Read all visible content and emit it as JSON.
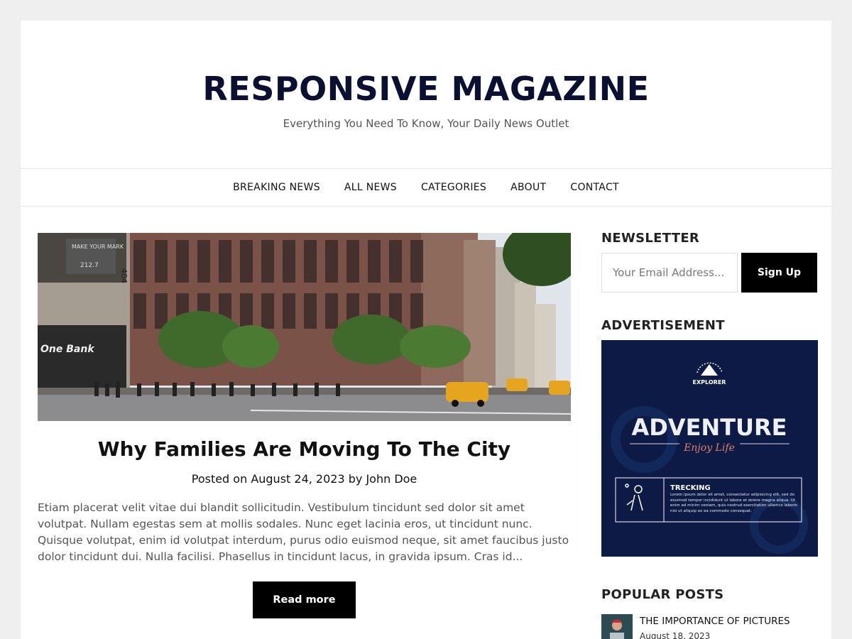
{
  "site": {
    "title": "RESPONSIVE MAGAZINE",
    "tagline": "Everything You Need To Know, Your Daily News Outlet"
  },
  "nav": {
    "items": [
      "BREAKING NEWS",
      "ALL NEWS",
      "CATEGORIES",
      "ABOUT",
      "CONTACT"
    ]
  },
  "post": {
    "title": "Why Families Are Moving To The City",
    "meta": "Posted on August 24, 2023 by John Doe",
    "excerpt": "Etiam placerat velit vitae dui blandit sollicitudin. Vestibulum tincidunt sed dolor sit amet volutpat. Nullam egestas sem at mollis sodales. Nunc eget lacinia eros, ut tincidunt nunc. Quisque volutpat, enim id volutpat interdum, purus odio euismod neque, sit amet faucibus justo dolor tincidunt dui. Nulla facilisi. Phasellus in tincidunt lacus, in gravida ipsum. Cras id...",
    "read_more": "Read more",
    "hero_signs": {
      "window": "MAKE YOUR MARK",
      "window_sub": "212.7",
      "bank": "One Bank",
      "number": "404"
    }
  },
  "sidebar": {
    "newsletter_title": "NEWSLETTER",
    "email_placeholder": "Your Email Address...",
    "signup_label": "Sign Up",
    "ad_title": "ADVERTISEMENT",
    "ad": {
      "logo_text": "EXPLORER",
      "headline": "ADVENTURE",
      "script": "Enjoy Life",
      "box_title": "TRECKING",
      "box_text": "Lorem ipsum dolor sit amet, consectetur adipisicing elit, sed do eiusmod tempor incididunt ut labore et dolore magna aliqua. Ut enim ad minim veniam, quis nostrud exercitation ullamco laboris nisi ut aliquip ex ea commodo consequat."
    },
    "popular_title": "POPULAR POSTS",
    "popular": [
      {
        "title": "THE IMPORTANCE OF PICTURES",
        "date": "August 18, 2023"
      }
    ]
  },
  "colors": {
    "page_bg": "#efefef",
    "title": "#0b1033",
    "button": "#000000",
    "ad_bg": "#0c1a45",
    "ad_accent": "#e0806a"
  }
}
